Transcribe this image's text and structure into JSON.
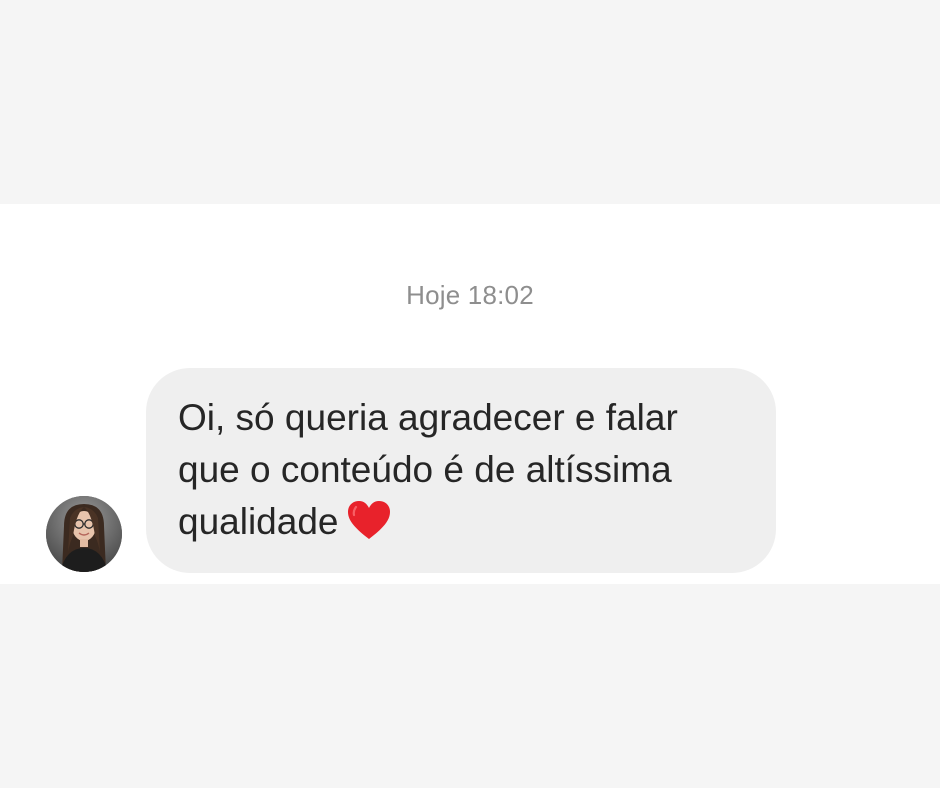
{
  "conversation": {
    "timestamp": "Hoje 18:02",
    "message": {
      "text": "Oi, só queria agradecer e falar\nque o conteúdo é de altíssima\nqualidade",
      "emoji": "heart-icon",
      "emoji_color": "#e8222b"
    },
    "sender": {
      "avatar": "profile-photo"
    }
  },
  "colors": {
    "page_background": "#f5f5f5",
    "chat_background": "#ffffff",
    "bubble_background": "#efefef",
    "message_text": "#262626",
    "timestamp_text": "#8e8e8e"
  }
}
